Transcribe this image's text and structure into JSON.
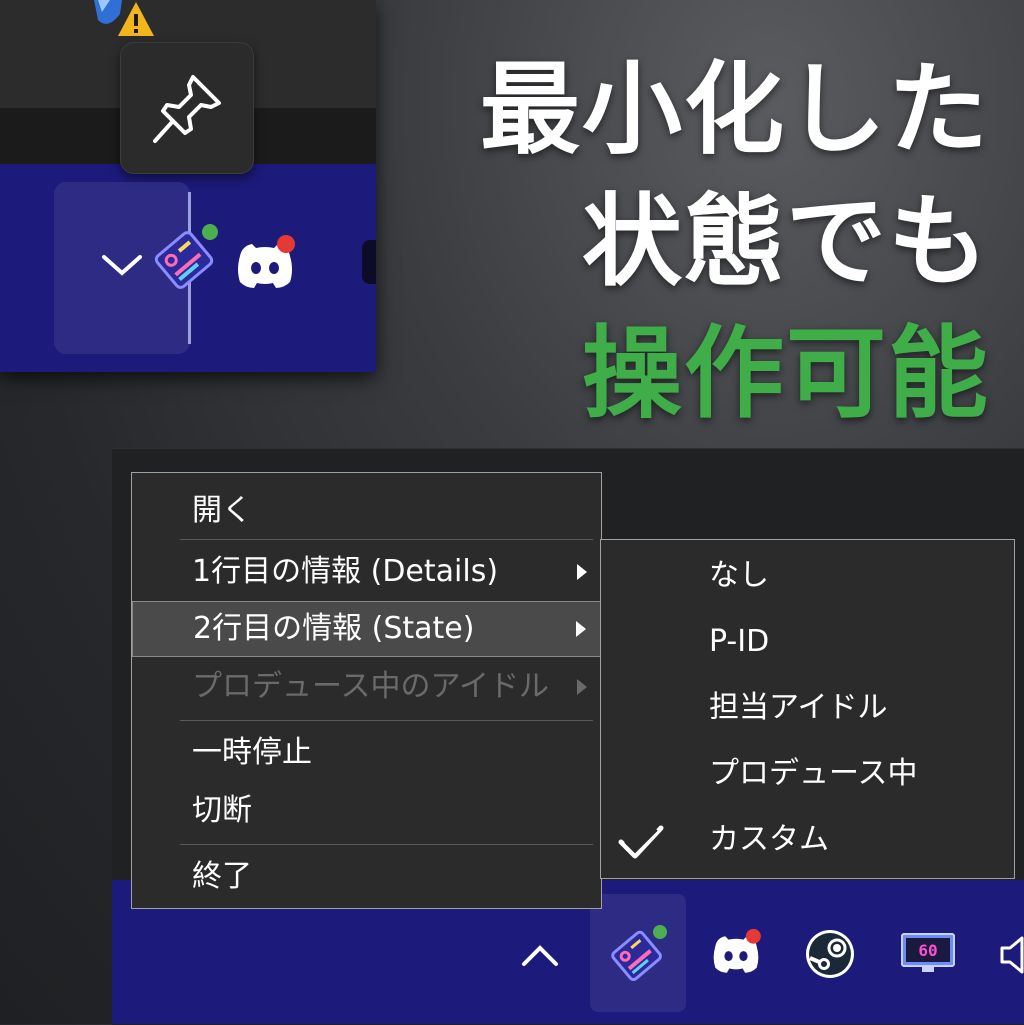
{
  "headline": {
    "line1": "最小化した",
    "line2": "状態でも",
    "line3": "操作可能"
  },
  "colors": {
    "accent_green": "#3fae49",
    "taskbar_blue": "#1c1a7a",
    "menu_bg": "#2b2b2b"
  },
  "inset": {
    "icons": [
      "shield-warning-icon",
      "pin-icon",
      "chevron-down-icon",
      "app-tray-icon",
      "discord-icon"
    ]
  },
  "context_menu": {
    "items": [
      {
        "label": "開く"
      },
      {
        "label": "1行目の情報 (Details)"
      },
      {
        "label": "2行目の情報 (State)"
      },
      {
        "label": "プロデュース中のアイドル"
      },
      {
        "label": "一時停止"
      },
      {
        "label": "切断"
      },
      {
        "label": "終了"
      }
    ]
  },
  "submenu": {
    "items": [
      {
        "label": "なし"
      },
      {
        "label": "P-ID"
      },
      {
        "label": "担当アイドル"
      },
      {
        "label": "プロデュース中"
      },
      {
        "label": "カスタム"
      }
    ],
    "checked": "カスタム"
  },
  "tray": {
    "icons": [
      "chevron-up-icon",
      "app-tray-icon",
      "discord-icon",
      "steam-icon",
      "monitor-fps-icon",
      "volume-icon"
    ],
    "monitor_text": "60"
  }
}
